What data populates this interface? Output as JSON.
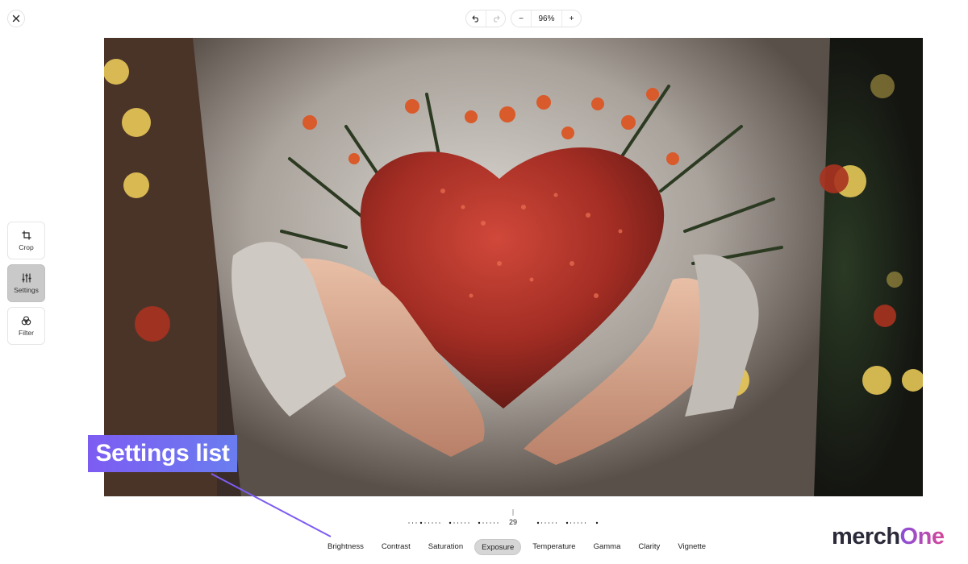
{
  "toolbar": {
    "close_icon": "close-icon",
    "undo_icon": "undo-icon",
    "redo_icon": "redo-icon",
    "zoom_out_label": "−",
    "zoom_value": "96%",
    "zoom_in_label": "+"
  },
  "tools": [
    {
      "label": "Crop",
      "icon": "crop-icon",
      "active": false
    },
    {
      "label": "Settings",
      "icon": "sliders-icon",
      "active": true
    },
    {
      "label": "Filter",
      "icon": "filter-icon",
      "active": false
    }
  ],
  "annotation": {
    "text": "Settings list"
  },
  "adjust": {
    "value": "29"
  },
  "settings": [
    {
      "label": "Brightness",
      "active": false
    },
    {
      "label": "Contrast",
      "active": false
    },
    {
      "label": "Saturation",
      "active": false
    },
    {
      "label": "Exposure",
      "active": true
    },
    {
      "label": "Temperature",
      "active": false
    },
    {
      "label": "Gamma",
      "active": false
    },
    {
      "label": "Clarity",
      "active": false
    },
    {
      "label": "Vignette",
      "active": false
    }
  ],
  "brand": {
    "part1": "merch",
    "part2": "One"
  },
  "colors": {
    "accent": "#7d5cf2",
    "active_tool": "#c9c9c9",
    "heart": "#b3362c"
  }
}
